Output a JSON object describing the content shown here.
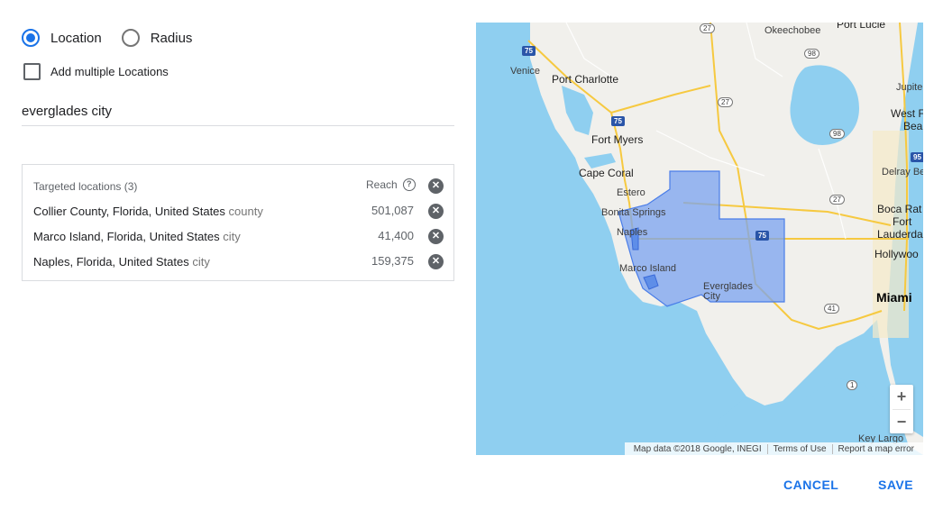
{
  "options": {
    "location_label": "Location",
    "radius_label": "Radius",
    "selected": "location",
    "multiple_label": "Add multiple Locations"
  },
  "search": {
    "value": "everglades city"
  },
  "targeted": {
    "header": "Targeted locations (3)",
    "reach_label": "Reach",
    "help_glyph": "?",
    "remove_glyph": "✕",
    "rows": [
      {
        "name": "Collier County, Florida, United States",
        "kind": "county",
        "reach": "501,087"
      },
      {
        "name": "Marco Island, Florida, United States",
        "kind": "city",
        "reach": "41,400"
      },
      {
        "name": "Naples, Florida, United States",
        "kind": "city",
        "reach": "159,375"
      }
    ]
  },
  "map": {
    "labels": {
      "venice": "Venice",
      "port_charlotte": "Port Charlotte",
      "okeechobee": "Okeechobee",
      "port_lucie": "Port Lucie",
      "jupiter": "Jupite",
      "west_palm": "West F",
      "beach": "Bea",
      "fort_myers": "Fort Myers",
      "cape_coral": "Cape Coral",
      "estero": "Estero",
      "bonita": "Bonita Springs",
      "naples": "Naples",
      "marco": "Marco Island",
      "everglades1": "Everglades",
      "everglades2": "City",
      "delray": "Delray Be",
      "boca": "Boca Rat",
      "fort": "Fort",
      "lauderdale": "Lauderda",
      "hollywood": "Hollywoo",
      "miami": "Miami",
      "key_largo": "Key Largo"
    },
    "shields": {
      "i75": "75",
      "i95": "95",
      "us27": "27",
      "us98": "98",
      "us41": "41",
      "us1": "1"
    },
    "zoom_in": "+",
    "zoom_out": "−",
    "attribution": [
      "Map data ©2018 Google, INEGI",
      "Terms of Use",
      "Report a map error"
    ]
  },
  "buttons": {
    "cancel": "CANCEL",
    "save": "SAVE"
  },
  "colors": {
    "accent": "#1a73e8",
    "water": "#8fcff0",
    "land": "#f1f0ec",
    "highlight": "#7aa3f0"
  }
}
